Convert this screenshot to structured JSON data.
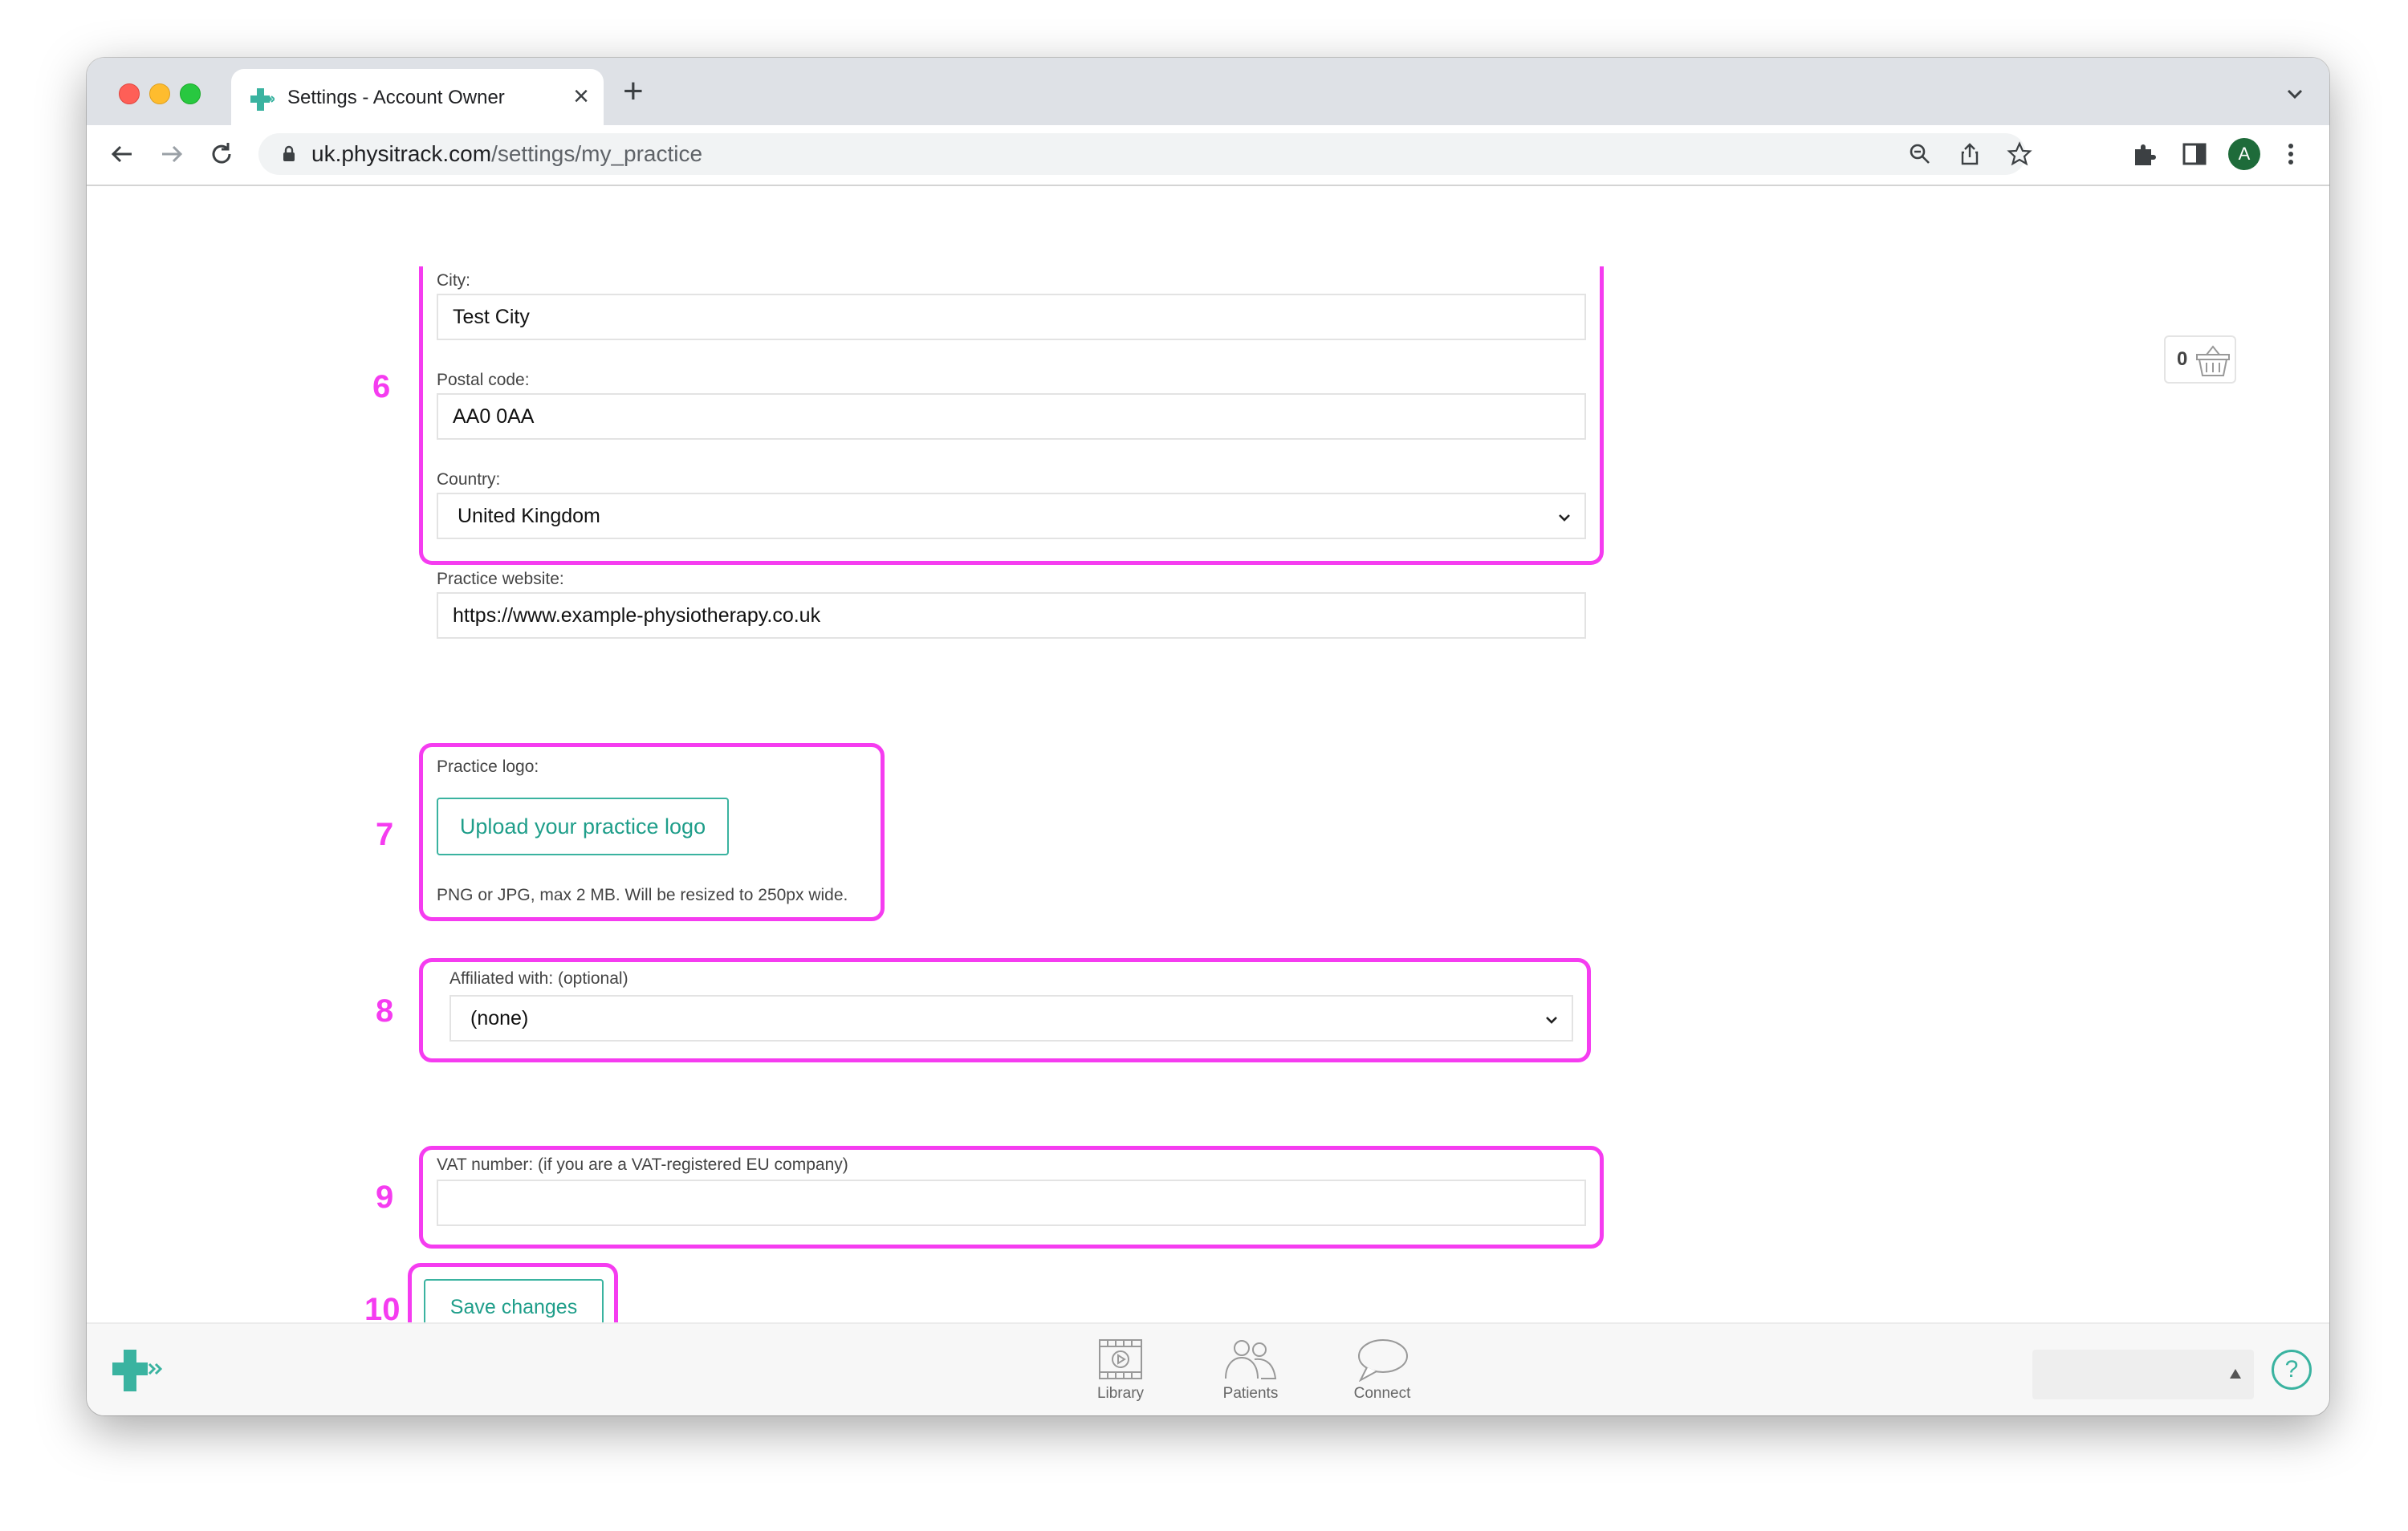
{
  "browser": {
    "tab_title": "Settings - Account Owner",
    "url_host": "uk.physitrack.com",
    "url_path": "/settings/my_practice",
    "profile_initial": "A"
  },
  "form": {
    "city_label": "City:",
    "city_value": "Test City",
    "postal_label": "Postal code:",
    "postal_value": "AA0 0AA",
    "country_label": "Country:",
    "country_value": "United Kingdom",
    "website_label": "Practice website:",
    "website_value": "https://www.example-physiotherapy.co.uk",
    "logo_label": "Practice logo:",
    "upload_button": "Upload your practice logo",
    "logo_hint": "PNG or JPG, max 2 MB. Will be resized to 250px wide.",
    "affiliated_label": "Affiliated with: (optional)",
    "affiliated_value": "(none)",
    "vat_label": "VAT number: (if you are a VAT-registered EU company)",
    "vat_value": "",
    "save_button": "Save changes"
  },
  "steps": {
    "s6": "6",
    "s7": "7",
    "s8": "8",
    "s9": "9",
    "s10": "10"
  },
  "cart": {
    "count": "0"
  },
  "bottom_nav": {
    "library": "Library",
    "patients": "Patients",
    "connect": "Connect"
  },
  "colors": {
    "highlight": "#f53cf0",
    "brand_teal": "#3ab3a0"
  }
}
